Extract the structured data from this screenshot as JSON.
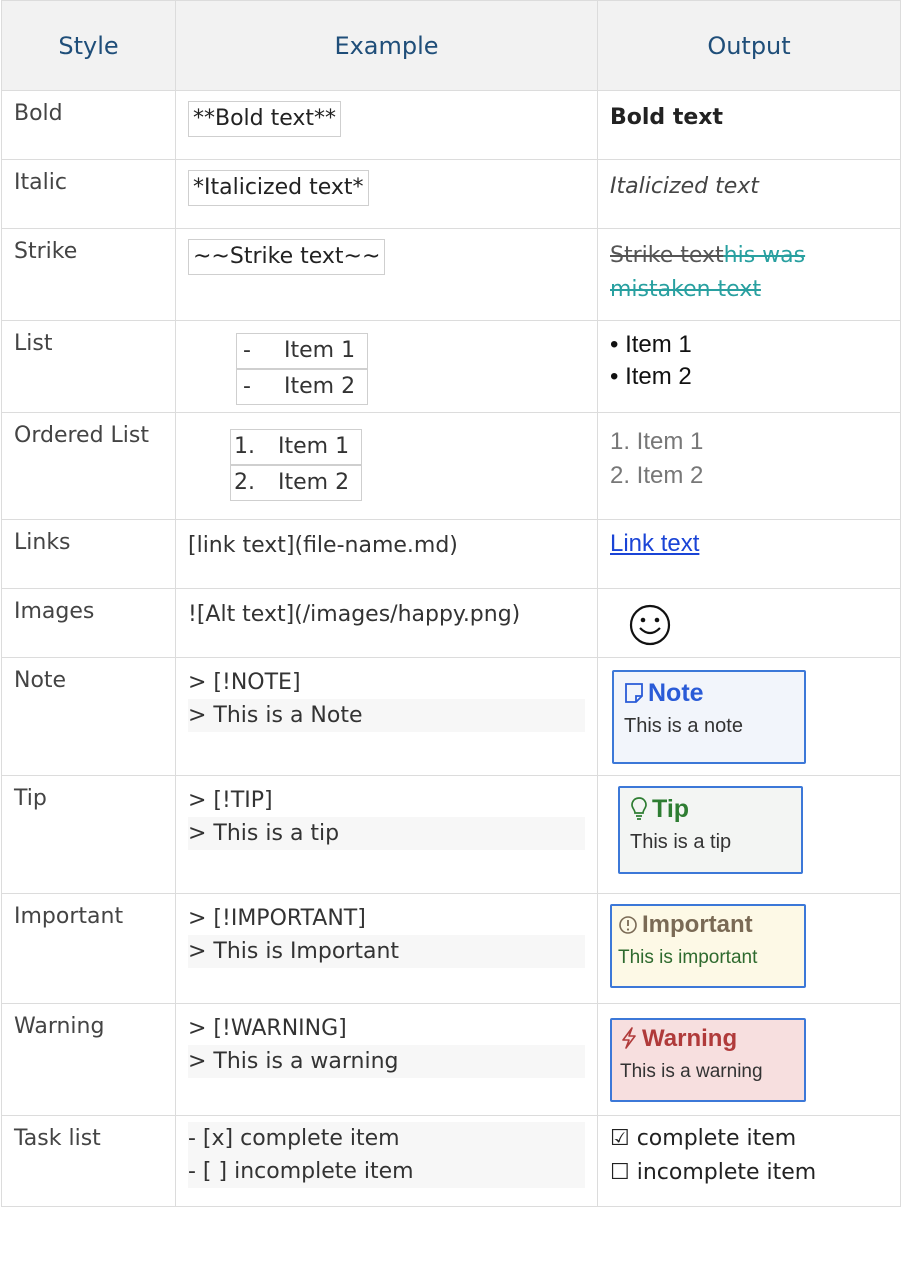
{
  "headers": {
    "style": "Style",
    "example": "Example",
    "output": "Output"
  },
  "rows": {
    "bold": {
      "style": "Bold",
      "example": "**Bold text**",
      "output": "Bold text"
    },
    "italic": {
      "style": "Italic",
      "example": "*Italicized text*",
      "output": "Italicized text"
    },
    "strike": {
      "style": "Strike",
      "example": "~~Strike text~~",
      "output_struck": "Strike text",
      "output_struck_teal_1": "his was",
      "output_struck_teal_2": "mistaken text"
    },
    "list": {
      "style": "List",
      "example_dash": "-",
      "example_items": [
        "Item 1",
        "Item 2"
      ],
      "output_items": [
        "• Item 1",
        "• Item 2"
      ]
    },
    "ordered": {
      "style": "Ordered List",
      "example_nums": [
        "1.",
        "2."
      ],
      "example_items": [
        "Item 1",
        "Item 2"
      ],
      "output_items": [
        "1.  Item 1",
        "2.  Item 2"
      ]
    },
    "links": {
      "style": "Links",
      "example": "[link text](file-name.md)",
      "output": "Link text"
    },
    "images": {
      "style": "Images",
      "example": "![Alt text](/images/happy.png)",
      "output_icon": "smiley-face-icon"
    },
    "note": {
      "style": "Note",
      "example_lines": [
        "> [!NOTE]",
        "> This is a Note"
      ],
      "title": "Note",
      "body": "This is a note",
      "icon": "note-icon"
    },
    "tip": {
      "style": "Tip",
      "example_lines": [
        "> [!TIP]",
        "> This is a tip"
      ],
      "title": "Tip",
      "body": "This is a tip",
      "icon": "lightbulb-icon"
    },
    "important": {
      "style": "Important",
      "example_lines": [
        "> [!IMPORTANT]",
        "> This is Important"
      ],
      "title": "Important",
      "body": "This is important",
      "icon": "info-circle-icon"
    },
    "warning": {
      "style": "Warning",
      "example_lines": [
        "> [!WARNING]",
        "> This is a warning"
      ],
      "title": "Warning",
      "body": "This is a warning",
      "icon": "lightning-icon"
    },
    "task": {
      "style": "Task list",
      "example_lines": [
        "- [x] complete item",
        "- [ ] incomplete item"
      ],
      "output_lines": [
        "☑ complete item",
        "☐ incomplete item"
      ]
    }
  },
  "colors": {
    "header_text": "#1f4e79",
    "link": "#1a44d6",
    "strike_teal": "#28a0a0",
    "alert_border": "#3c78d8"
  }
}
